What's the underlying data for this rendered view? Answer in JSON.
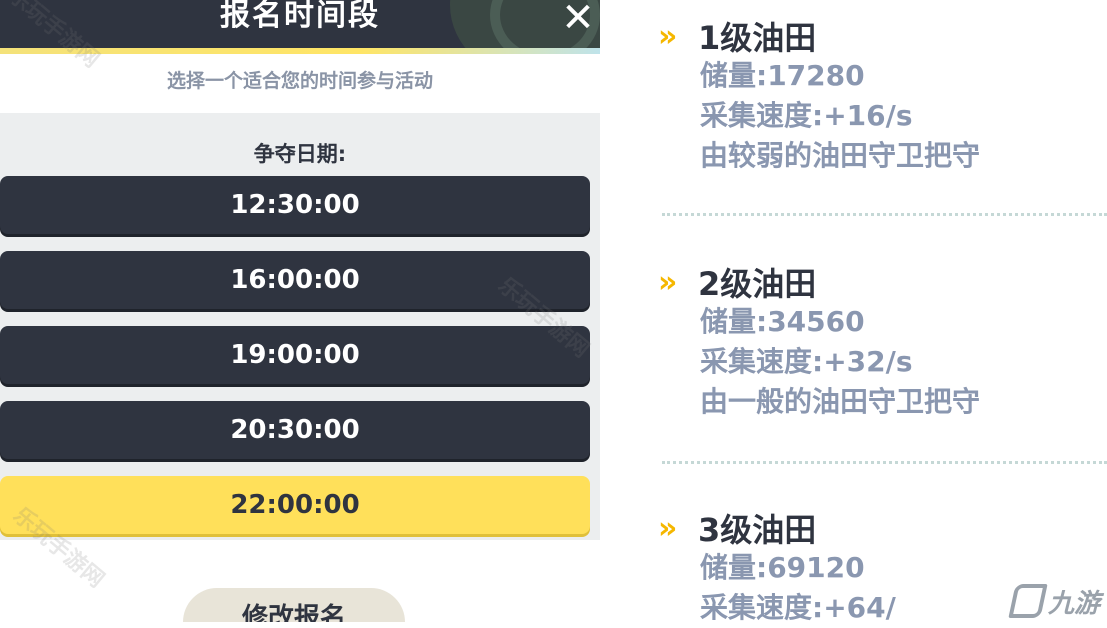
{
  "dialog": {
    "title": "报名时间段",
    "close_icon": "close-x-icon",
    "subtitle": "选择一个适合您的时间参与活动",
    "date_label": "争夺日期:",
    "time_slots": [
      {
        "time": "12:30:00",
        "selected": false
      },
      {
        "time": "16:00:00",
        "selected": false
      },
      {
        "time": "19:00:00",
        "selected": false
      },
      {
        "time": "20:30:00",
        "selected": false
      },
      {
        "time": "22:00:00",
        "selected": true
      }
    ],
    "modify_button": "修改报名"
  },
  "oil_fields": [
    {
      "title": "1级油田",
      "reserve": "储量:17280",
      "speed": "采集速度:+16/s",
      "guard": "由较弱的油田守卫把守"
    },
    {
      "title": "2级油田",
      "reserve": "储量:34560",
      "speed": "采集速度:+32/s",
      "guard": "由一般的油田守卫把守"
    },
    {
      "title": "3级油田",
      "reserve": "储量:69120",
      "speed": "采集速度:+64/"
    }
  ],
  "chevron_glyph": "»",
  "watermark_text": "乐玩手游网",
  "logo_text": "九游",
  "colors": {
    "dark": "#2f3440",
    "selected": "#ffe05a",
    "accent": "#f5b700",
    "muted_text": "#8a97b0"
  }
}
